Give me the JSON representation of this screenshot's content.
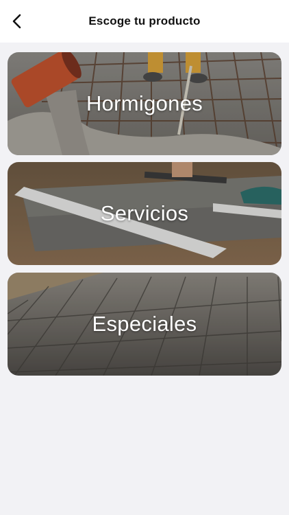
{
  "header": {
    "title": "Escoge tu producto",
    "back_icon": "chevron-left-icon"
  },
  "products": [
    {
      "label": "Hormigones",
      "image": "concrete-pour-photo"
    },
    {
      "label": "Servicios",
      "image": "concrete-screed-photo"
    },
    {
      "label": "Especiales",
      "image": "stamped-concrete-photo"
    }
  ],
  "colors": {
    "background": "#f2f2f5",
    "header_bg": "#ffffff",
    "label_text": "#ffffff"
  }
}
